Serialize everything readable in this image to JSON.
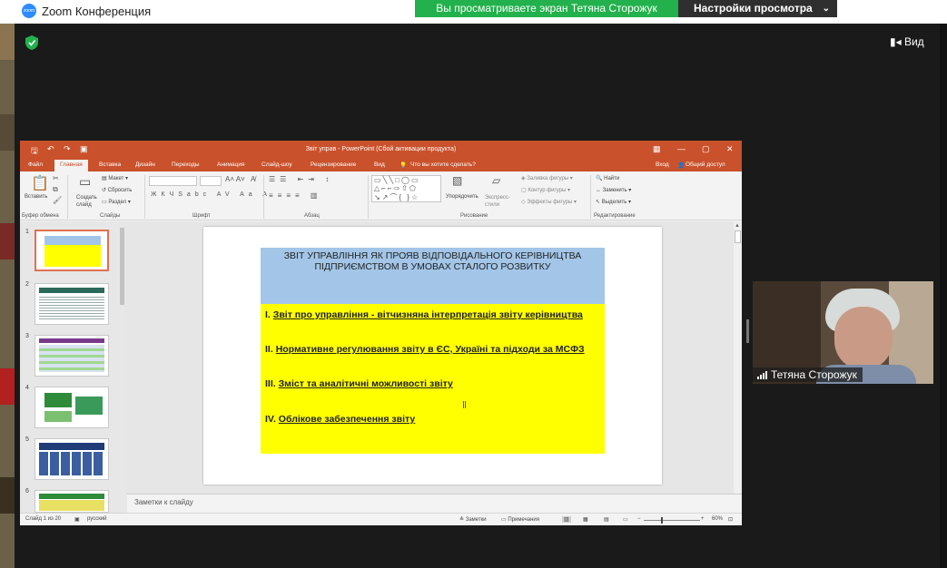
{
  "window": {
    "title": "Zoom Конференция",
    "logo_text": "zoom"
  },
  "share": {
    "banner": "Вы просматриваете экран Тетяна Сторожук",
    "view_settings": "Настройки просмотра",
    "view_button": "Вид"
  },
  "ppt": {
    "title": "Звіт управ - PowerPoint (Сбой активации продукта)",
    "tabs": [
      "Файл",
      "Главная",
      "Вставка",
      "Дизайн",
      "Переходы",
      "Анимация",
      "Слайд-шоу",
      "Рецензирование",
      "Вид"
    ],
    "tell_me": "Что вы хотите сделать?",
    "sign_in": "Вход",
    "share": "Общий доступ",
    "ribbon": {
      "paste": "Вставить",
      "new_slide": "Создать слайд",
      "layout": "Макет",
      "reset": "Сбросить",
      "section": "Раздел",
      "arrange": "Упорядочить",
      "quick_styles": "Экспресс-стили",
      "shape_fill": "Заливка фигуры",
      "shape_outline": "Контур фигуры",
      "shape_effects": "Эффекты фигуры",
      "find": "Найти",
      "replace": "Заменить",
      "select": "Выделить",
      "groups": [
        "Буфер обмена",
        "Слайды",
        "Шрифт",
        "Абзац",
        "Рисование",
        "Редактирование"
      ]
    },
    "slide_numbers": [
      "1",
      "2",
      "3",
      "4",
      "5",
      "6"
    ],
    "slide": {
      "title": "ЗВІТ УПРАВЛІННЯ ЯК ПРОЯВ ВІДПОВІДАЛЬНОГО КЕРІВНИЦТВА ПІДПРИЄМСТВОМ В УМОВАХ СТАЛОГО РОЗВИТКУ",
      "items": [
        {
          "num": "I.",
          "text": "Звіт про управління - вітчизняна інтерпретація звіту керівництва"
        },
        {
          "num": "II.",
          "text": "Нормативне регулювання звіту в ЄС, Україні та підходи за МСФЗ"
        },
        {
          "num": "III.",
          "text": " Зміст та аналітичні можливості звіту"
        },
        {
          "num": "IV.",
          "text": "Облікове забезпечення звіту"
        }
      ]
    },
    "notes_placeholder": "Заметки к слайду",
    "status": {
      "slide_of": "Слайд 1 из 20",
      "language": "русский",
      "notes": "Заметки",
      "comments": "Примечания",
      "zoom": "60%"
    }
  },
  "participant": {
    "name": "Тетяна Сторожук"
  },
  "colors": {
    "zoom_blue": "#2d8cff",
    "share_green": "#22b14c",
    "ppt_orange": "#c9512b",
    "slide_blue": "#a3c6e8",
    "slide_yellow": "#ffff00"
  }
}
